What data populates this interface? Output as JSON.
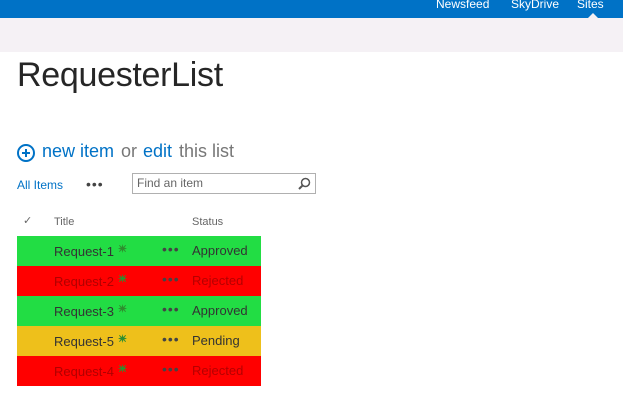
{
  "topnav": {
    "items": [
      "Newsfeed",
      "SkyDrive",
      "Sites"
    ]
  },
  "page": {
    "title": "RequesterList"
  },
  "actions": {
    "new_item": "new item",
    "or": "or",
    "edit": "edit",
    "this_list": "this list"
  },
  "views": {
    "current": "All Items",
    "more": "•••"
  },
  "search": {
    "placeholder": "Find an item"
  },
  "table": {
    "columns": [
      "Title",
      "Status"
    ],
    "rows": [
      {
        "title": "Request-1",
        "status": "Approved",
        "color": "#22dd44"
      },
      {
        "title": "Request-2",
        "status": "Rejected",
        "color": "#ff0000"
      },
      {
        "title": "Request-3",
        "status": "Approved",
        "color": "#22dd44"
      },
      {
        "title": "Request-5",
        "status": "Pending",
        "color": "#eec01b"
      },
      {
        "title": "Request-4",
        "status": "Rejected",
        "color": "#ff0000"
      }
    ],
    "row_menu": "•••"
  },
  "colors": {
    "suite_bar": "#0072c6",
    "ribbon": "#f5f1f5",
    "link": "#0072c6"
  }
}
